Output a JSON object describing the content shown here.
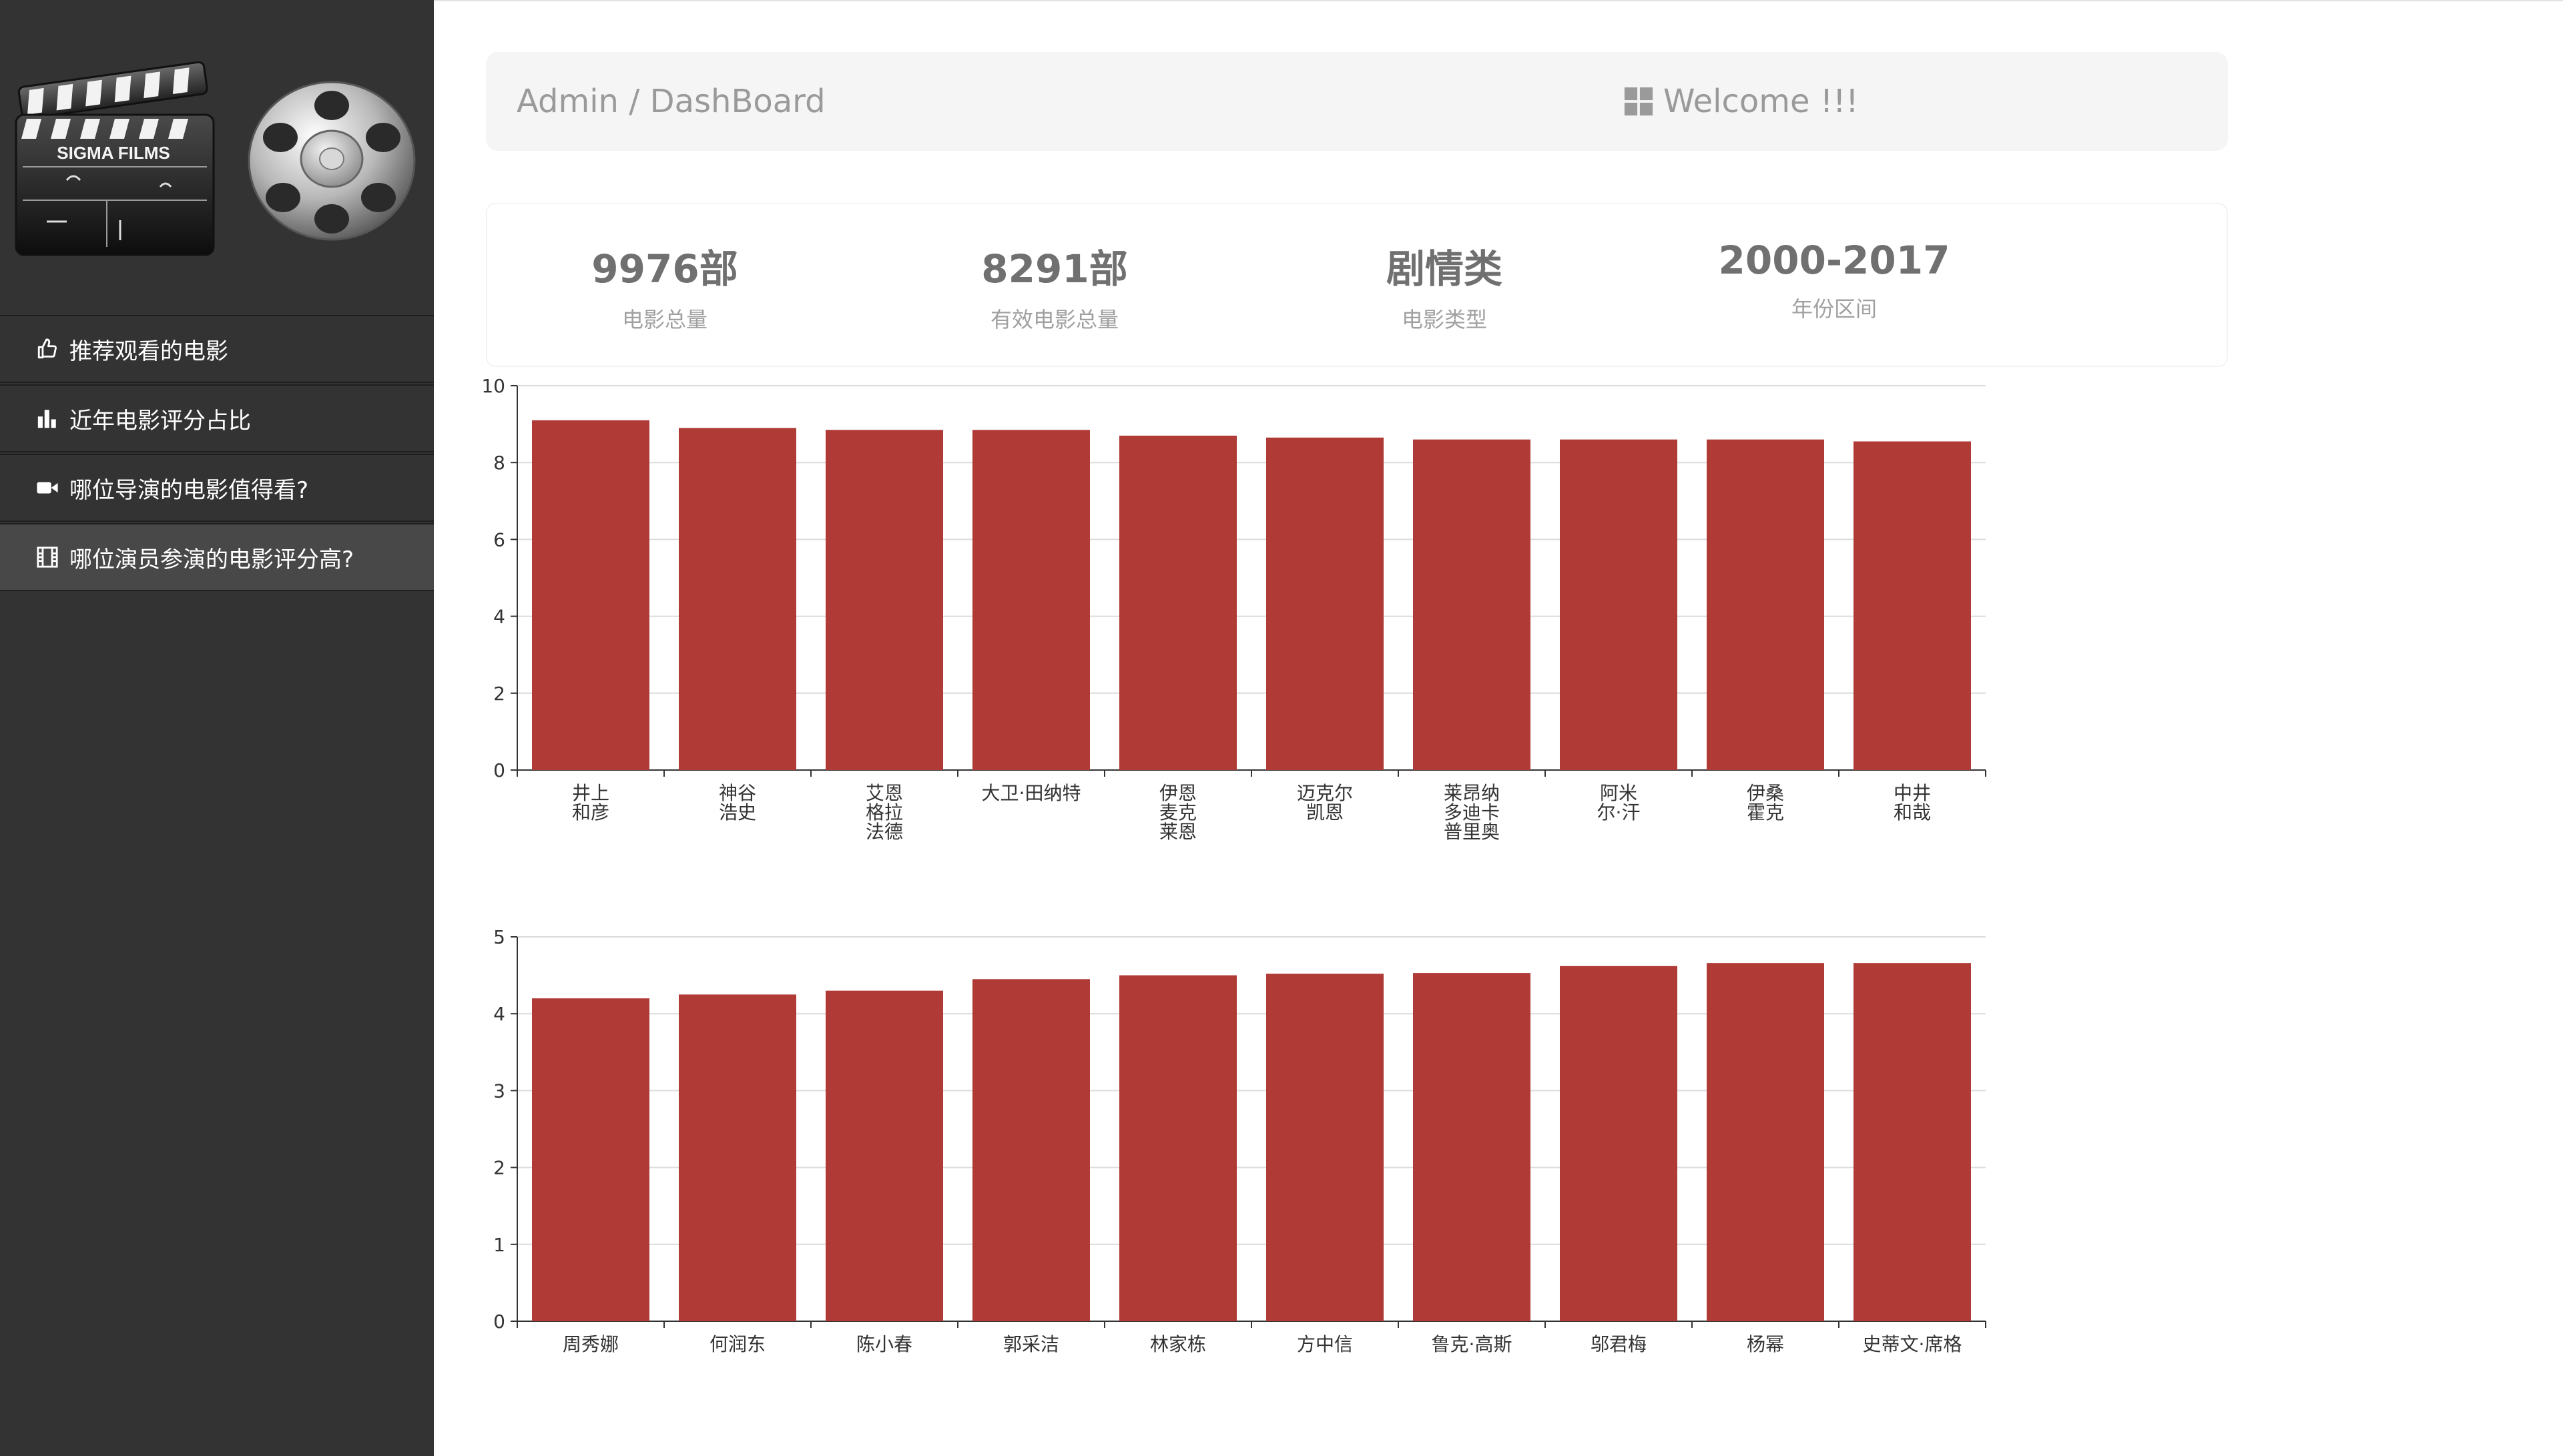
{
  "brand": {
    "clapper_text": "SIGMA FILMS"
  },
  "menu": [
    {
      "icon": "thumbs-up-icon",
      "label": "推荐观看的电影"
    },
    {
      "icon": "bar-chart-icon",
      "label": "近年电影评分占比"
    },
    {
      "icon": "video-camera-icon",
      "label": "哪位导演的电影值得看?"
    },
    {
      "icon": "film-icon",
      "label": "哪位演员参演的电影评分高?"
    }
  ],
  "breadcrumb": "Admin / DashBoard",
  "welcome": "Welcome !!!",
  "stats": [
    {
      "value": "9976部",
      "label": "电影总量"
    },
    {
      "value": "8291部",
      "label": "有效电影总量"
    },
    {
      "value": "剧情类",
      "label": "电影类型"
    },
    {
      "value": "2000-2017",
      "label": "年份区间"
    }
  ],
  "colors": {
    "bar": "#b03a36",
    "sidebar": "#333333"
  },
  "chart_data": [
    {
      "type": "bar",
      "categories": [
        "井上和彦",
        "神谷浩史",
        "艾恩格拉法德",
        "大卫·田纳特",
        "伊恩麦克莱恩",
        "迈克尔凯恩",
        "莱昂纳多迪卡普里奥",
        "阿米尔·汗",
        "伊桑霍克",
        "中井和哉"
      ],
      "category_lines": [
        [
          "井上",
          "和彦"
        ],
        [
          "神谷",
          "浩史"
        ],
        [
          "艾恩",
          "格拉",
          "法德"
        ],
        [
          "大卫·田纳特"
        ],
        [
          "伊恩",
          "麦克",
          "莱恩"
        ],
        [
          "迈克尔",
          "凯恩"
        ],
        [
          "莱昂纳",
          "多迪卡",
          "普里奥"
        ],
        [
          "阿米",
          "尔·汗"
        ],
        [
          "伊桑",
          "霍克"
        ],
        [
          "中井",
          "和哉"
        ]
      ],
      "values": [
        9.1,
        8.9,
        8.85,
        8.85,
        8.7,
        8.65,
        8.6,
        8.6,
        8.6,
        8.55
      ],
      "ylim": [
        0,
        10
      ],
      "yticks": [
        0,
        2,
        4,
        6,
        8,
        10
      ],
      "grid": true
    },
    {
      "type": "bar",
      "categories": [
        "周秀娜",
        "何润东",
        "陈小春",
        "郭采洁",
        "林家栋",
        "方中信",
        "鲁克·高斯",
        "邬君梅",
        "杨幂",
        "史蒂文·席格"
      ],
      "category_lines": [
        [
          "周秀娜"
        ],
        [
          "何润东"
        ],
        [
          "陈小春"
        ],
        [
          "郭采洁"
        ],
        [
          "林家栋"
        ],
        [
          "方中信"
        ],
        [
          "鲁克·高斯"
        ],
        [
          "邬君梅"
        ],
        [
          "杨幂"
        ],
        [
          "史蒂文·席格"
        ]
      ],
      "values": [
        4.2,
        4.25,
        4.3,
        4.45,
        4.5,
        4.52,
        4.53,
        4.62,
        4.66,
        4.66
      ],
      "ylim": [
        0,
        5
      ],
      "yticks": [
        0,
        1,
        2,
        3,
        4,
        5
      ],
      "grid": true
    }
  ]
}
